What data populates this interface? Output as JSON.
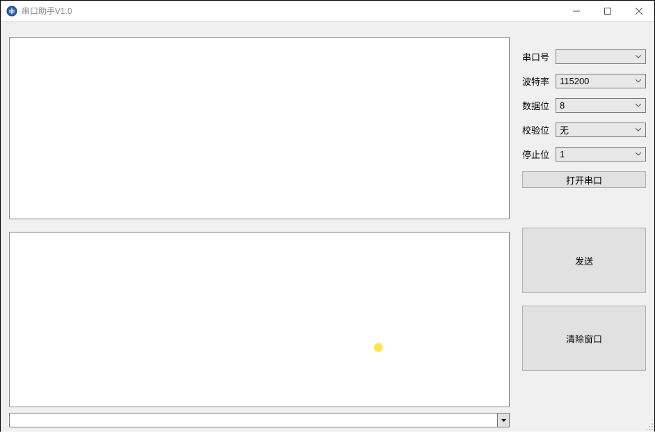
{
  "window": {
    "title": "串口助手V1.0"
  },
  "settings": {
    "port_label": "串口号",
    "port_value": "",
    "baud_label": "波特率",
    "baud_value": "115200",
    "databits_label": "数据位",
    "databits_value": "8",
    "parity_label": "校验位",
    "parity_value": "无",
    "stopbits_label": "停止位",
    "stopbits_value": "1"
  },
  "buttons": {
    "open_port": "打开串口",
    "send": "发送",
    "clear": "清除窗口"
  },
  "output_text": "",
  "input_text": "",
  "history_value": ""
}
